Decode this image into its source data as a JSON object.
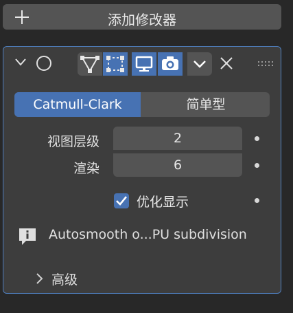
{
  "toolbar": {
    "add_modifier_label": "添加修改器"
  },
  "modifier": {
    "subdivision_type_options": [
      "Catmull-Clark",
      "简单型"
    ],
    "selected_type": "Catmull-Clark",
    "levels_viewport_label": "视图层级",
    "levels_viewport_value": "2",
    "render_levels_label": "渲染",
    "render_levels_value": "6",
    "optimal_display_label": "优化显示",
    "optimal_display_checked": true,
    "info_message": "Autosmooth o...PU subdivision",
    "advanced_label": "高级"
  },
  "colors": {
    "accent": "#4772b3",
    "panel_border": "#4f7fbf"
  }
}
